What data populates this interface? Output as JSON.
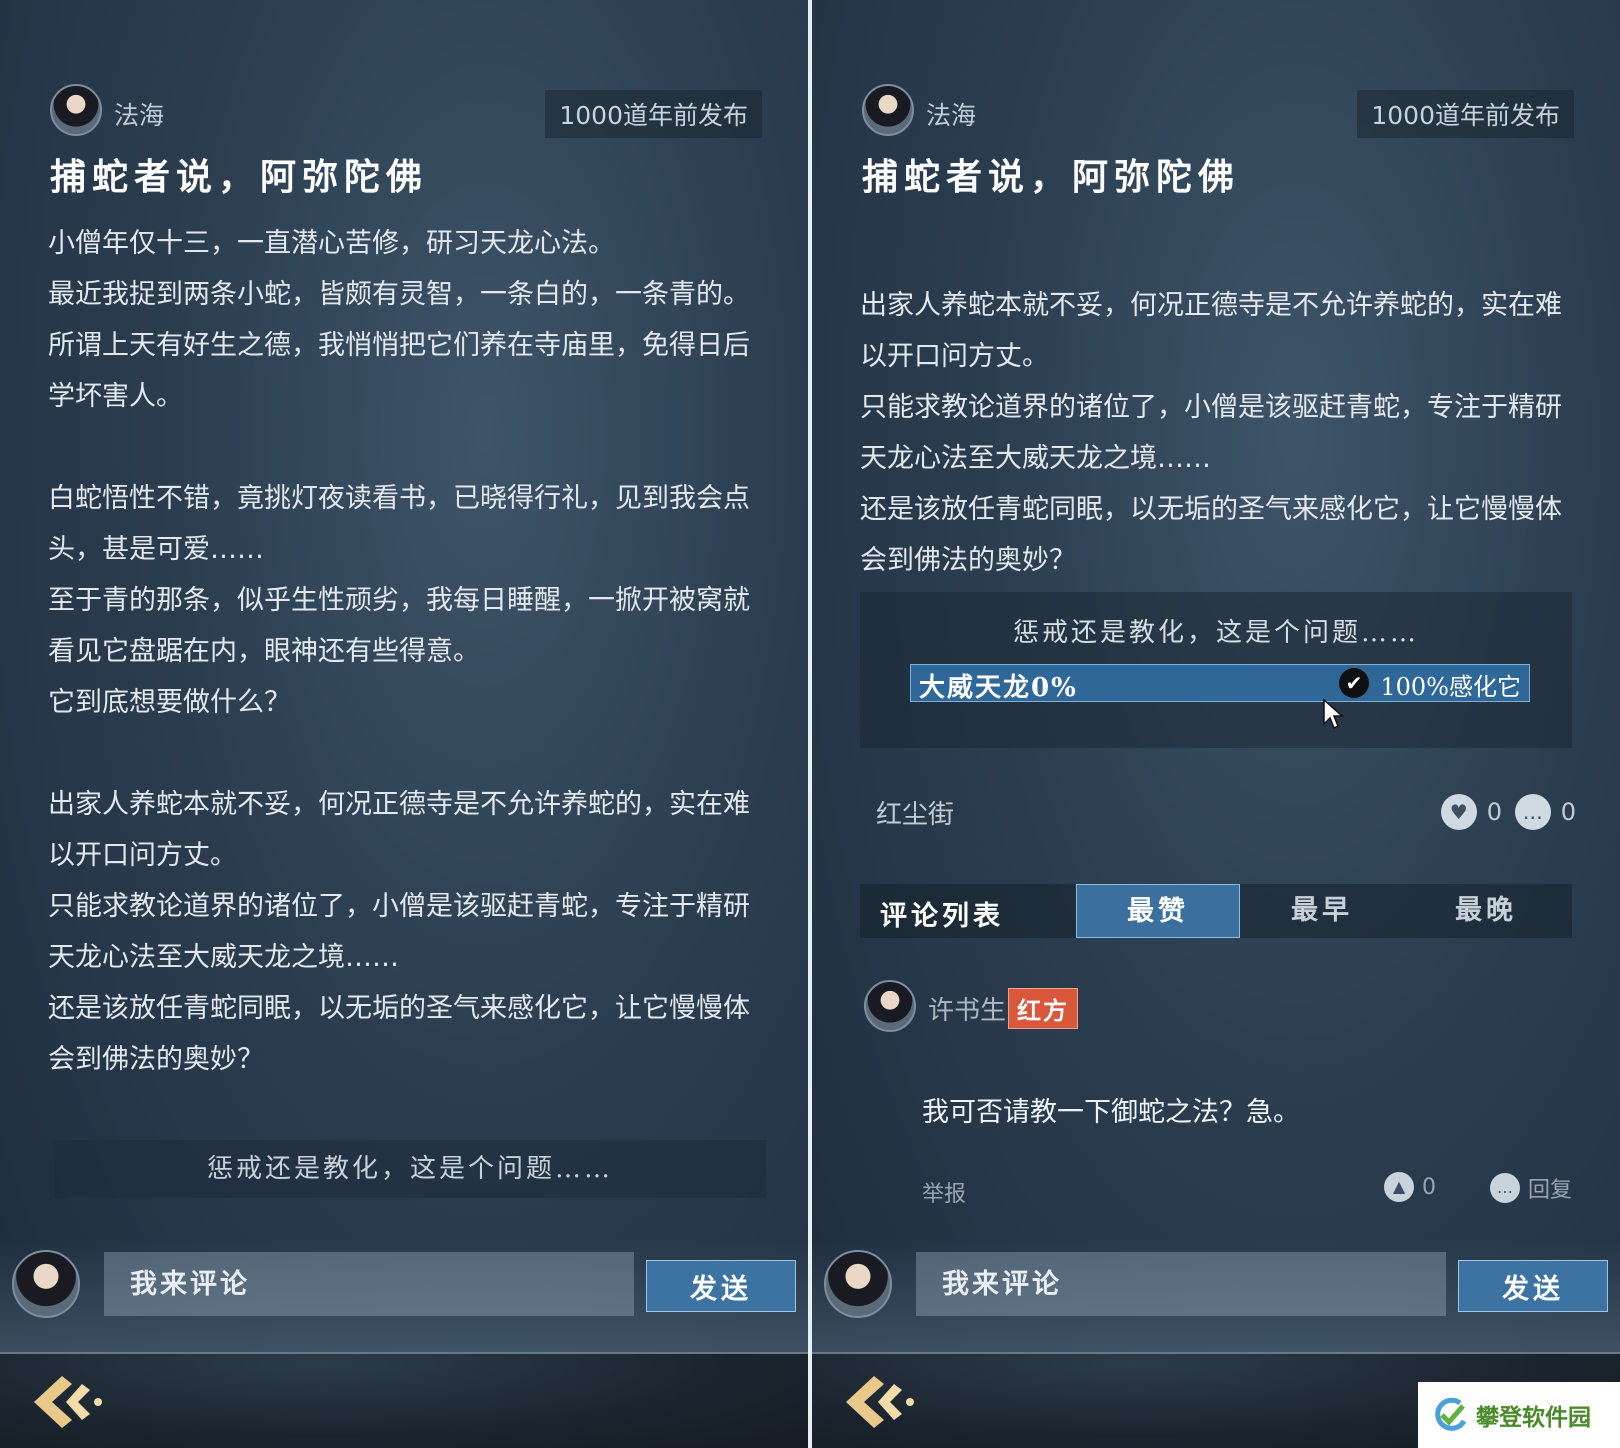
{
  "post": {
    "author": "法海",
    "timestamp": "1000道年前发布",
    "title": "捕蛇者说，阿弥陀佛",
    "paragraphs_left": [
      "小僧年仅十三，一直潜心苦修，研习天龙心法。",
      "最近我捉到两条小蛇，皆颇有灵智，一条白的，一条青的。",
      "所谓上天有好生之德，我悄悄把它们养在寺庙里，免得日后学坏害人。",
      "",
      "白蛇悟性不错，竟挑灯夜读看书，已晓得行礼，见到我会点头，甚是可爱……",
      "至于青的那条，似乎生性顽劣，我每日睡醒，一掀开被窝就看见它盘踞在内，眼神还有些得意。",
      "它到底想要做什么？",
      "",
      "出家人养蛇本就不妥，何况正德寺是不允许养蛇的，实在难以开口问方丈。",
      "只能求教论道界的诸位了，小僧是该驱赶青蛇，专注于精研天龙心法至大威天龙之境……",
      "还是该放任青蛇同眠，以无垢的圣气来感化它，让它慢慢体会到佛法的奥妙？"
    ],
    "paragraphs_right": [
      "出家人养蛇本就不妥，何况正德寺是不允许养蛇的，实在难以开口问方丈。",
      "只能求教论道界的诸位了，小僧是该驱赶青蛇，专注于精研天龙心法至大威天龙之境……",
      "还是该放任青蛇同眠，以无垢的圣气来感化它，让它慢慢体会到佛法的奥妙？"
    ]
  },
  "poll": {
    "question": "惩戒还是教化，这是个问题……",
    "option_a_label": "大威天龙0%",
    "option_b_label": "100%感化它",
    "option_b_fraction": 1.0,
    "selected": "option_b"
  },
  "topic": {
    "label": "红尘街",
    "likes": "0",
    "comments": "0"
  },
  "comment_tabs": {
    "heading": "评论列表",
    "tabs": [
      "最赞",
      "最早",
      "最晚"
    ],
    "active_index": 0
  },
  "comments": [
    {
      "author": "许书生",
      "badge": "红方",
      "text": "我可否请教一下御蛇之法？急。",
      "report_label": "举报",
      "likes": "0",
      "reply_label": "回复"
    }
  ],
  "composer": {
    "placeholder": "我来评论",
    "send_label": "发送"
  },
  "watermark": "攀登软件园",
  "colors": {
    "accent": "#3a6f9e",
    "badge_red": "#d9583c",
    "watermark_green": "#4a8a2a"
  },
  "icons": [
    "avatar",
    "heart-icon",
    "comment-bubble-icon",
    "checkmark-icon",
    "cursor-icon",
    "back-arrow-icon",
    "thumb-icon",
    "reply-bubble-icon"
  ]
}
